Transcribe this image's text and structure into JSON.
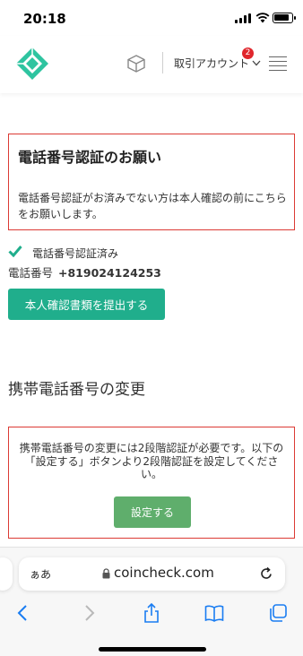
{
  "status_bar": {
    "time": "20:18",
    "signal_icon": "cellular-signal-icon",
    "wifi_icon": "wifi-icon",
    "battery_icon": "battery-icon",
    "battery_level": 0.9
  },
  "header": {
    "logo_icon": "coincheck-logo-icon",
    "cube_icon": "cube-icon",
    "account_label": "取引アカウント",
    "notification_count": "2",
    "menu_icon": "hamburger-menu-icon"
  },
  "phone_notice": {
    "title": "電話番号認証のお願い",
    "body": "電話番号認証がお済みでない方は本人確認の前にこちらをお願いします。"
  },
  "verification": {
    "status_label": "電話番号認証済み",
    "phone_label": "電話番号",
    "phone_value": "+819024124253",
    "submit_button": "本人確認書類を提出する"
  },
  "phone_change": {
    "heading": "携帯電話番号の変更",
    "notice": "携帯電話番号の変更には2段階認証が必要です。以下の「設定する」ボタンより2段階認証を設定してください。",
    "setup_button": "設定する"
  },
  "browser": {
    "aa_label": "ぁあ",
    "url": "coincheck.com",
    "toolbar": [
      "back-icon",
      "forward-icon",
      "share-icon",
      "bookmarks-icon",
      "tabs-icon"
    ]
  },
  "colors": {
    "accent_green": "#20ae8c",
    "setup_green": "#5fae6c",
    "notice_border": "#dc3a34",
    "badge_red": "#e0262c",
    "ios_blue": "#1a7df2"
  }
}
